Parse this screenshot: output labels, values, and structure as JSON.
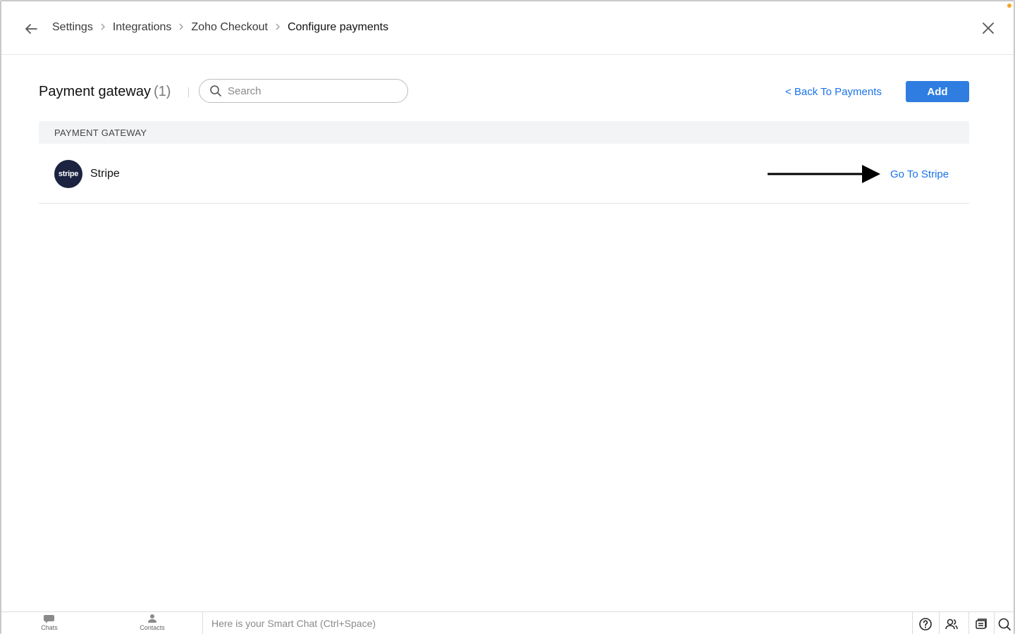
{
  "header": {
    "breadcrumb": [
      "Settings",
      "Integrations",
      "Zoho Checkout",
      "Configure payments"
    ]
  },
  "toolbar": {
    "title": "Payment gateway",
    "count": "(1)",
    "search_placeholder": "Search",
    "back_link": "< Back To Payments",
    "add_label": "Add"
  },
  "table": {
    "column_header": "PAYMENT GATEWAY",
    "rows": [
      {
        "logo_text": "stripe",
        "name": "Stripe",
        "action": "Go To Stripe"
      }
    ]
  },
  "bottom_bar": {
    "chats_label": "Chats",
    "contacts_label": "Contacts",
    "smart_chat_placeholder": "Here is your Smart Chat (Ctrl+Space)"
  },
  "colors": {
    "accent": "#2f7de1",
    "link": "#1a73e8",
    "stripe_logo_bg": "#1b2340",
    "notification_dot": "#f5a623"
  },
  "icons": [
    "back-arrow-icon",
    "chevron-right-icon",
    "close-icon",
    "search-icon",
    "chat-bubble-icon",
    "contact-icon",
    "help-icon",
    "people-icon",
    "feed-icon",
    "search-icon"
  ]
}
